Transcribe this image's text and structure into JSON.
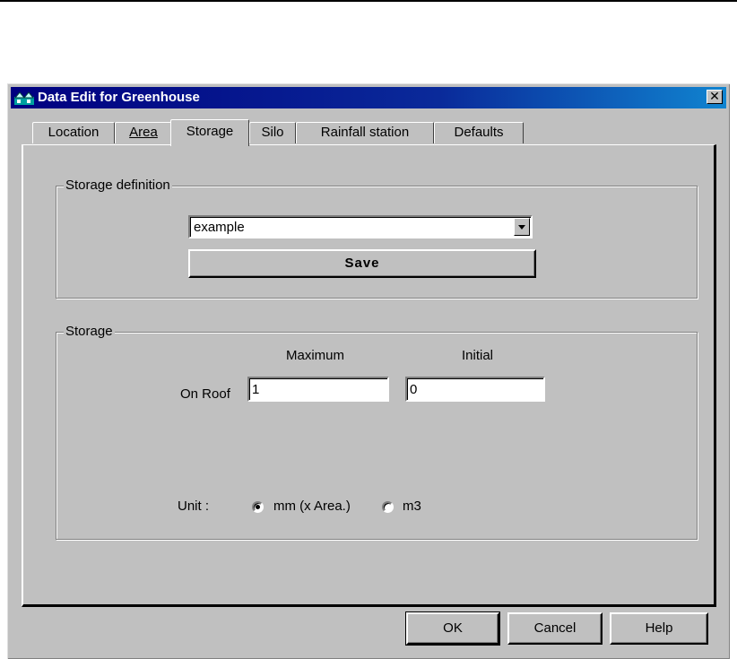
{
  "window": {
    "title": "Data Edit for Greenhouse",
    "close_glyph": "✕",
    "title_icon": "greenhouse-app-icon"
  },
  "tabs": [
    {
      "label": "Location",
      "active": false
    },
    {
      "label": "Area",
      "accel": "A",
      "active": false
    },
    {
      "label": "Storage",
      "active": true
    },
    {
      "label": "Silo",
      "active": false
    },
    {
      "label": "Rainfall station",
      "active": false
    },
    {
      "label": "Defaults",
      "active": false
    }
  ],
  "storage_definition": {
    "legend": "Storage definition",
    "selected": "example",
    "save_label": "Save"
  },
  "storage": {
    "legend": "Storage",
    "col_maximum": "Maximum",
    "col_initial": "Initial",
    "row_label": "On Roof",
    "maximum_value": "1",
    "initial_value": "0",
    "unit_label": "Unit :",
    "unit_option_1": "mm (x Area.)",
    "unit_option_2": "m3",
    "unit_selected": "mm (x Area.)"
  },
  "footer": {
    "ok_label": "OK",
    "cancel_label": "Cancel",
    "help_label": "Help"
  },
  "colors": {
    "titlebar_start": "#000080",
    "titlebar_end": "#1084d0",
    "face": "#c0c0c0"
  }
}
